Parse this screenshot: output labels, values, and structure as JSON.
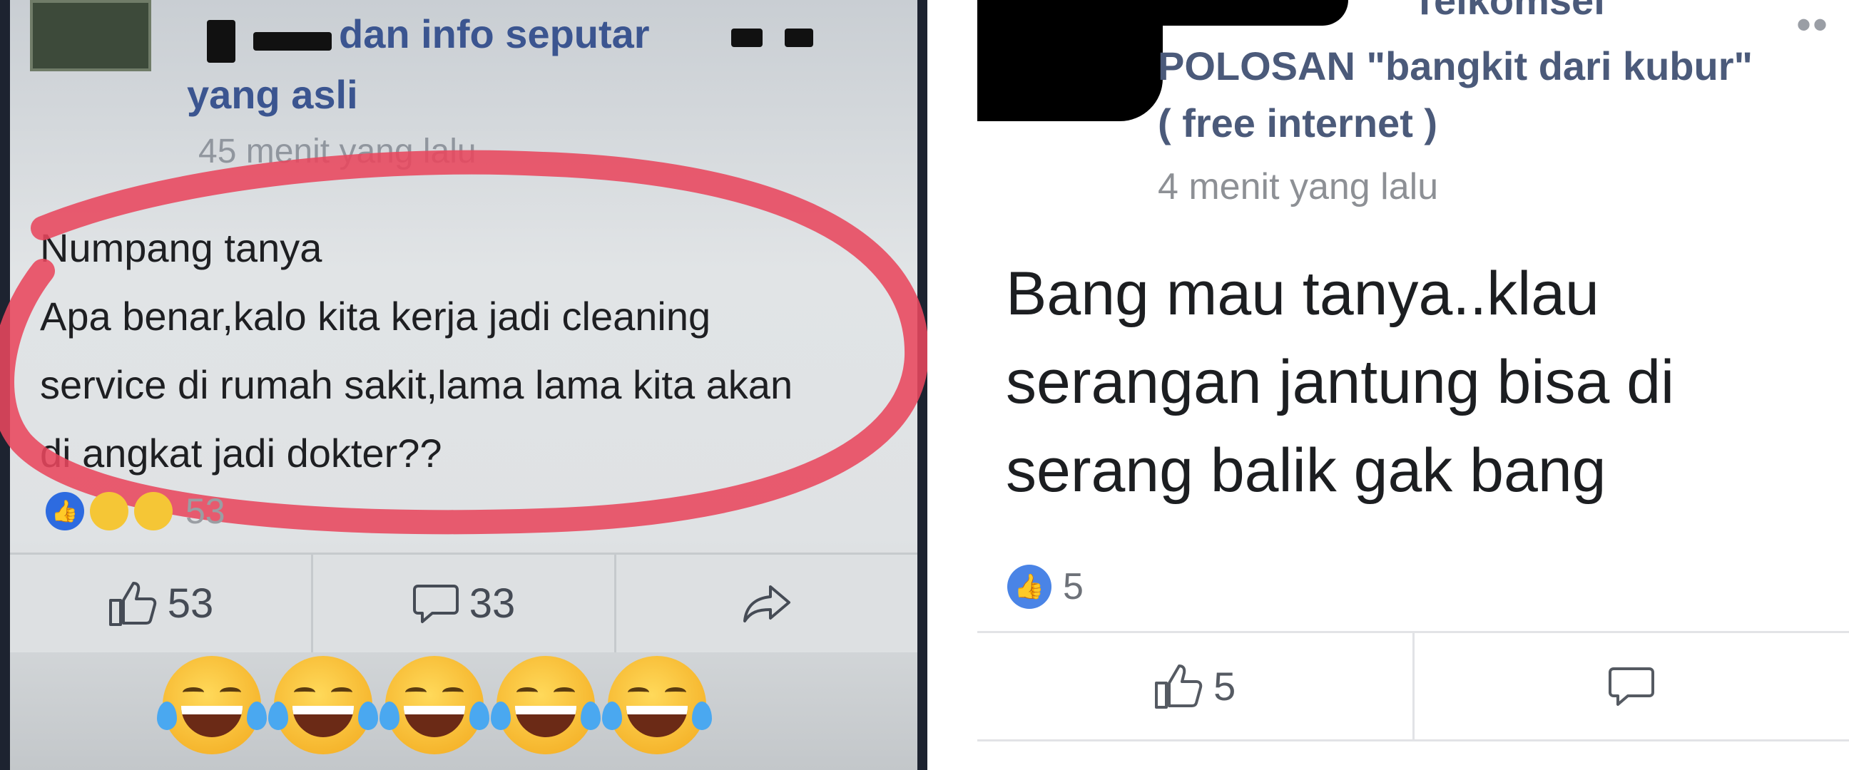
{
  "left_post": {
    "page_name_line1": "dan info seputar",
    "page_name_line2": "yang asli",
    "timestamp": "45 menit yang lalu",
    "body_line1": "Numpang tanya",
    "body_line2": "Apa benar,kalo kita kerja jadi cleaning",
    "body_line3": "service di rumah sakit,lama lama kita akan",
    "body_line4": "di angkat jadi dokter??",
    "reaction_count": "53",
    "like_count": "53",
    "comment_count": "33",
    "icons": {
      "like": "thumbs-up-icon",
      "comment": "comment-bubble-icon",
      "share": "share-arrow-icon",
      "emoji": "tears-of-joy-emoji"
    },
    "emoji_count": 5,
    "annotation_color": "#e8475d"
  },
  "right_post": {
    "header_fragment": "Telkomsel",
    "page_name": "POLOSAN \"bangkit dari kubur\"",
    "page_subtitle": "( free internet )",
    "timestamp": "4 menit yang lalu",
    "body_line1": "Bang mau tanya..klau",
    "body_line2": "serangan jantung bisa di",
    "body_line3": "serang balik gak bang",
    "reaction_count": "5",
    "like_count": "5",
    "icons": {
      "like": "thumbs-up-icon",
      "comment": "comment-bubble-icon",
      "more": "more-dots-icon"
    },
    "accent_color": "#4a84e6",
    "name_color": "#4b5a7a"
  }
}
